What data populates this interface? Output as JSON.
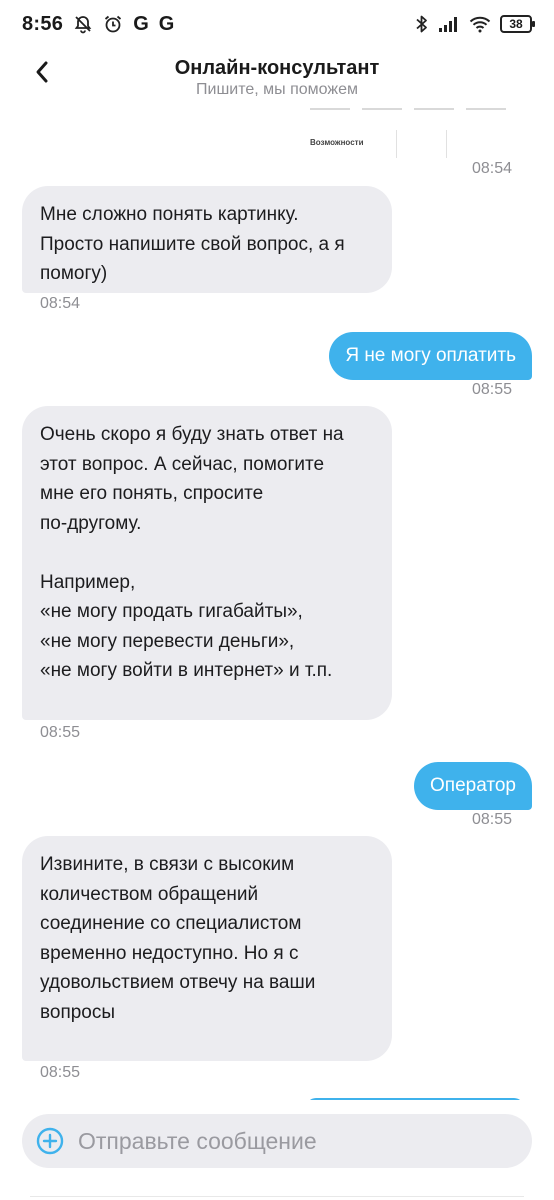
{
  "status_bar": {
    "time": "8:56",
    "g1": "G",
    "g2": "G",
    "battery": "38",
    "icons": [
      "mute-bell-icon",
      "alarm-icon",
      "bluetooth-icon",
      "signal-icon",
      "wifi-icon",
      "battery-icon"
    ]
  },
  "header": {
    "title": "Онлайн-консультант",
    "subtitle": "Пишите, мы поможем",
    "back_icon": "chevron-left-icon"
  },
  "image_preview": {
    "caption": "Возможности"
  },
  "messages": [
    {
      "sender": "bot",
      "type": "image",
      "time": "08:54"
    },
    {
      "sender": "bot",
      "text": "Мне сложно понять картинку.\nПросто напишите свой вопрос, а я\nпомогу)",
      "time": "08:54"
    },
    {
      "sender": "user",
      "text": "Я не могу оплатить",
      "time": "08:55"
    },
    {
      "sender": "bot",
      "text": "Очень скоро я буду знать ответ на\nэтот вопрос. А сейчас, помогите\nмне его понять, спросите\nпо-другому.\n\nНапример,\n«не могу продать гигабайты»,\n«не могу перевести деньги»,\n«не могу войти в интернет» и т.п.",
      "time": "08:55"
    },
    {
      "sender": "user",
      "text": "Оператор",
      "time": "08:55"
    },
    {
      "sender": "bot",
      "text": "Извините, в связи с высоким\nколичеством обращений\nсоединение со специалистом\nвременно недоступно. Но я с\nудовольствием отвечу на ваши\nвопросы",
      "time": "08:55"
    }
  ],
  "composer": {
    "placeholder": "Отправьте сообщение",
    "value": "",
    "add_icon": "plus-circle-icon"
  },
  "colors": {
    "outgoing_bubble": "#3fb2ec",
    "incoming_bubble": "#ececf0",
    "timestamp": "#8e8e93",
    "accent": "#3fb2ec"
  }
}
